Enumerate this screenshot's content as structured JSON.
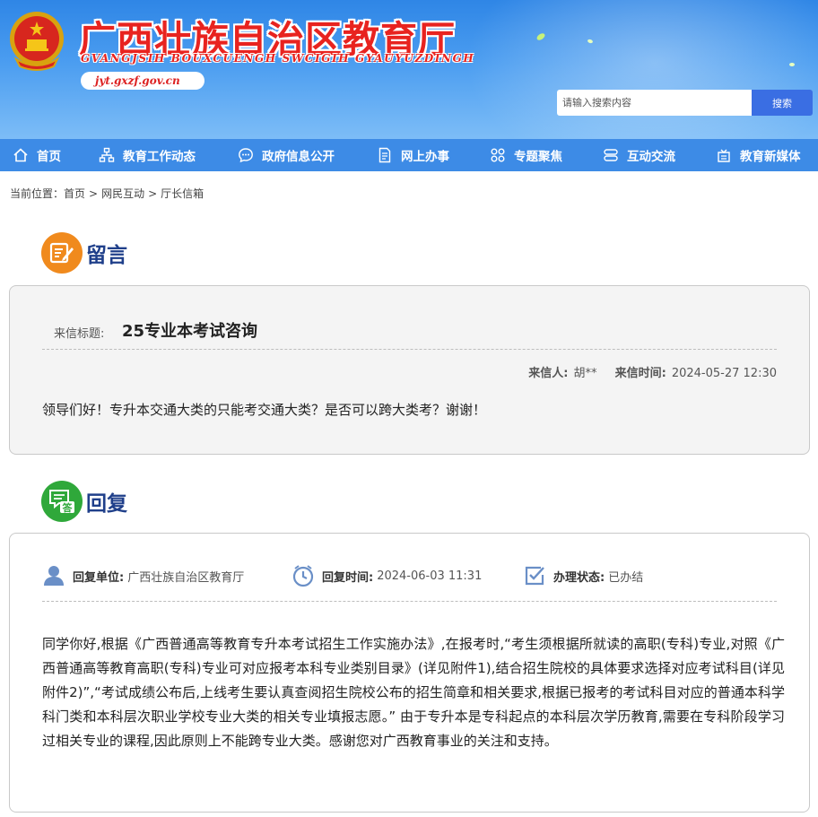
{
  "header": {
    "title": "广西壮族自治区教育厅",
    "subtitle": "GVANGJSIH BOUXCUENGH SWCIGIH GYAUYUZDINGH",
    "domain": "jyt.gxzf.gov.cn",
    "search_placeholder": "请输入搜索内容",
    "search_button": "搜索"
  },
  "nav": {
    "items": [
      {
        "label": "首页",
        "icon": "home-icon"
      },
      {
        "label": "教育工作动态",
        "icon": "sitemap-icon"
      },
      {
        "label": "政府信息公开",
        "icon": "chat-icon"
      },
      {
        "label": "网上办事",
        "icon": "document-icon"
      },
      {
        "label": "专题聚焦",
        "icon": "grid-icon"
      },
      {
        "label": "互动交流",
        "icon": "exchange-icon"
      },
      {
        "label": "教育新媒体",
        "icon": "media-icon"
      }
    ]
  },
  "breadcrumb": {
    "prefix": "当前位置：",
    "items": [
      "首页",
      "网民互动",
      "厅长信箱"
    ],
    "separator": ">"
  },
  "message": {
    "heading": "留言",
    "title_label": "来信标题:",
    "title": "25专业本考试咨询",
    "sender_label": "来信人:",
    "sender": "胡**",
    "time_label": "来信时间:",
    "time": "2024-05-27 12:30",
    "body": "领导们好！专升本交通大类的只能考交通大类？是否可以跨大类考？谢谢！"
  },
  "reply": {
    "heading": "回复",
    "unit_label": "回复单位:",
    "unit": "广西壮族自治区教育厅",
    "time_label": "回复时间:",
    "time": "2024-06-03 11:31",
    "status_label": "办理状态:",
    "status": "已办结",
    "body": "同学你好,根据《广西普通高等教育专升本考试招生工作实施办法》,在报考时,“考生须根据所就读的高职(专科)专业,对照《广西普通高等教育高职(专科)专业可对应报考本科专业类别目录》(详见附件1),结合招生院校的具体要求选择对应考试科目(详见附件2)”,“考试成绩公布后,上线考生要认真查阅招生院校公布的招生简章和相关要求,根据已报考的考试科目对应的普通本科学科门类和本科层次职业学校专业大类的相关专业填报志愿。” 由于专升本是专科起点的本科层次学历教育,需要在专科阶段学习过相关专业的课程,因此原则上不能跨专业大类。感谢您对广西教育事业的关注和支持。"
  },
  "colors": {
    "header_blue": "#2f86e6",
    "nav_blue": "#3d8be6",
    "title_red": "#e8231f",
    "heading_navy": "#1f3f8a",
    "message_icon_orange": "#f08a1d",
    "reply_icon_green": "#2fa83a"
  }
}
